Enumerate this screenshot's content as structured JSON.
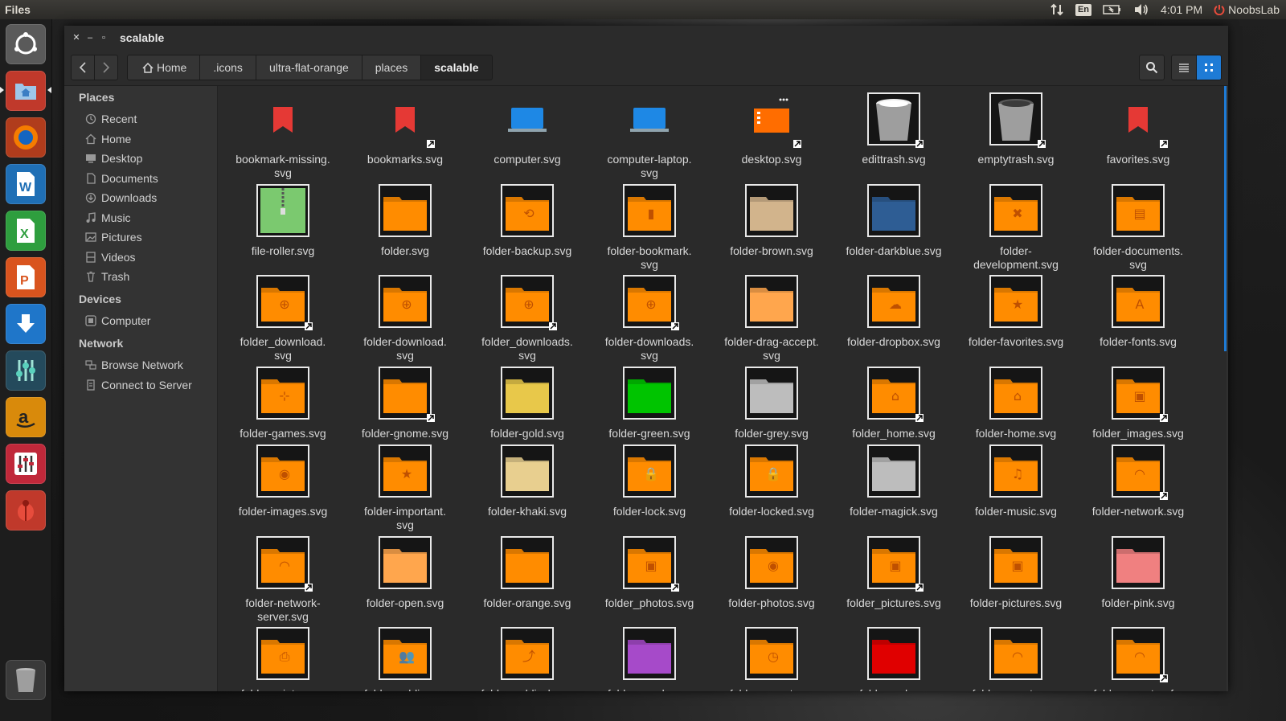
{
  "panel": {
    "app_title": "Files",
    "lang": "En",
    "time": "4:01 PM",
    "user": "NoobsLab"
  },
  "launcher": {
    "items": [
      "ubuntu-dash-icon",
      "files-app-icon",
      "firefox-icon",
      "libreoffice-writer-icon",
      "libreoffice-calc-icon",
      "libreoffice-impress-icon",
      "ubuntu-software-icon",
      "system-settings-icon",
      "amazon-icon",
      "mixer-app-icon",
      "bug-report-icon",
      "trash-launcher-icon"
    ]
  },
  "window": {
    "title": "scalable"
  },
  "breadcrumbs": [
    {
      "label": "Home",
      "active": false
    },
    {
      "label": ".icons",
      "active": false
    },
    {
      "label": "ultra-flat-orange",
      "active": false
    },
    {
      "label": "places",
      "active": false
    },
    {
      "label": "scalable",
      "active": true
    }
  ],
  "sidebar": {
    "places_heading": "Places",
    "places": [
      {
        "label": "Recent",
        "icon": "recent-icon"
      },
      {
        "label": "Home",
        "icon": "home-icon"
      },
      {
        "label": "Desktop",
        "icon": "desktop-icon"
      },
      {
        "label": "Documents",
        "icon": "documents-icon"
      },
      {
        "label": "Downloads",
        "icon": "downloads-icon"
      },
      {
        "label": "Music",
        "icon": "music-icon"
      },
      {
        "label": "Pictures",
        "icon": "pictures-icon"
      },
      {
        "label": "Videos",
        "icon": "videos-icon"
      },
      {
        "label": "Trash",
        "icon": "trash-icon"
      }
    ],
    "devices_heading": "Devices",
    "devices": [
      {
        "label": "Computer",
        "icon": "computer-icon"
      }
    ],
    "network_heading": "Network",
    "network": [
      {
        "label": "Browse Network",
        "icon": "network-icon"
      },
      {
        "label": "Connect to Server",
        "icon": "server-icon"
      }
    ]
  },
  "files": [
    {
      "name": "bookmark-missing.\nsvg",
      "kind": "bookmark",
      "color": "#e53935",
      "link": false
    },
    {
      "name": "bookmarks.svg",
      "kind": "bookmark",
      "color": "#e53935",
      "link": true
    },
    {
      "name": "computer.svg",
      "kind": "laptop",
      "color": "#1e88e5",
      "link": false
    },
    {
      "name": "computer-laptop.\nsvg",
      "kind": "laptop",
      "color": "#1e88e5",
      "link": false
    },
    {
      "name": "desktop.svg",
      "kind": "desktop",
      "color": "#ff6d00",
      "link": true
    },
    {
      "name": "edittrash.svg",
      "kind": "trashfull",
      "color": "#9e9e9e",
      "link": true
    },
    {
      "name": "emptytrash.svg",
      "kind": "trash",
      "color": "#9e9e9e",
      "link": true
    },
    {
      "name": "favorites.svg",
      "kind": "bookmark",
      "color": "#e53935",
      "link": true
    },
    {
      "name": "file-roller.svg",
      "kind": "archive",
      "color": "#7bc96f",
      "link": false
    },
    {
      "name": "folder.svg",
      "kind": "folder",
      "color": "#ff8c00",
      "glyph": "",
      "link": false
    },
    {
      "name": "folder-backup.svg",
      "kind": "folder",
      "color": "#ff8c00",
      "glyph": "⟲",
      "link": false
    },
    {
      "name": "folder-bookmark.\nsvg",
      "kind": "folder",
      "color": "#ff8c00",
      "glyph": "▮",
      "link": false
    },
    {
      "name": "folder-brown.svg",
      "kind": "folder",
      "color": "#d2b48c",
      "glyph": "",
      "link": false
    },
    {
      "name": "folder-darkblue.svg",
      "kind": "folder",
      "color": "#2e5d94",
      "glyph": "",
      "link": false
    },
    {
      "name": "folder-\ndevelopment.svg",
      "kind": "folder",
      "color": "#ff8c00",
      "glyph": "✖",
      "link": false
    },
    {
      "name": "folder-documents.\nsvg",
      "kind": "folder",
      "color": "#ff8c00",
      "glyph": "▤",
      "link": false
    },
    {
      "name": "folder_download.\nsvg",
      "kind": "folder",
      "color": "#ff8c00",
      "glyph": "⊕",
      "link": true
    },
    {
      "name": "folder-download.\nsvg",
      "kind": "folder",
      "color": "#ff8c00",
      "glyph": "⊕",
      "link": false
    },
    {
      "name": "folder_downloads.\nsvg",
      "kind": "folder",
      "color": "#ff8c00",
      "glyph": "⊕",
      "link": true
    },
    {
      "name": "folder-downloads.\nsvg",
      "kind": "folder",
      "color": "#ff8c00",
      "glyph": "⊕",
      "link": true
    },
    {
      "name": "folder-drag-accept.\nsvg",
      "kind": "folder",
      "color": "#ffa64d",
      "glyph": "",
      "link": false
    },
    {
      "name": "folder-dropbox.svg",
      "kind": "folder",
      "color": "#ff8c00",
      "glyph": "☁",
      "link": false
    },
    {
      "name": "folder-favorites.svg",
      "kind": "folder",
      "color": "#ff8c00",
      "glyph": "★",
      "link": false
    },
    {
      "name": "folder-fonts.svg",
      "kind": "folder",
      "color": "#ff8c00",
      "glyph": "A",
      "link": false
    },
    {
      "name": "folder-games.svg",
      "kind": "folder",
      "color": "#ff8c00",
      "glyph": "⊹",
      "link": false
    },
    {
      "name": "folder-gnome.svg",
      "kind": "folder",
      "color": "#ff8c00",
      "glyph": "",
      "link": true
    },
    {
      "name": "folder-gold.svg",
      "kind": "folder",
      "color": "#e8c84a",
      "glyph": "",
      "link": false
    },
    {
      "name": "folder-green.svg",
      "kind": "folder",
      "color": "#00c400",
      "glyph": "",
      "link": false
    },
    {
      "name": "folder-grey.svg",
      "kind": "folder",
      "color": "#bdbdbd",
      "glyph": "",
      "link": false
    },
    {
      "name": "folder_home.svg",
      "kind": "folder",
      "color": "#ff8c00",
      "glyph": "⌂",
      "link": true
    },
    {
      "name": "folder-home.svg",
      "kind": "folder",
      "color": "#ff8c00",
      "glyph": "⌂",
      "link": false
    },
    {
      "name": "folder_images.svg",
      "kind": "folder",
      "color": "#ff8c00",
      "glyph": "▣",
      "link": true
    },
    {
      "name": "folder-images.svg",
      "kind": "folder",
      "color": "#ff8c00",
      "glyph": "◉",
      "link": false
    },
    {
      "name": "folder-important.\nsvg",
      "kind": "folder",
      "color": "#ff8c00",
      "glyph": "★",
      "link": false
    },
    {
      "name": "folder-khaki.svg",
      "kind": "folder",
      "color": "#e8cf8f",
      "glyph": "",
      "link": false
    },
    {
      "name": "folder-lock.svg",
      "kind": "folder",
      "color": "#ff8c00",
      "glyph": "🔒",
      "link": false
    },
    {
      "name": "folder-locked.svg",
      "kind": "folder",
      "color": "#ff8c00",
      "glyph": "🔒",
      "link": false
    },
    {
      "name": "folder-magick.svg",
      "kind": "folder",
      "color": "#bdbdbd",
      "glyph": "",
      "link": false
    },
    {
      "name": "folder-music.svg",
      "kind": "folder",
      "color": "#ff8c00",
      "glyph": "♫",
      "link": false
    },
    {
      "name": "folder-network.svg",
      "kind": "folder",
      "color": "#ff8c00",
      "glyph": "◠",
      "link": true
    },
    {
      "name": "folder-network-\nserver.svg",
      "kind": "folder",
      "color": "#ff8c00",
      "glyph": "◠",
      "link": true
    },
    {
      "name": "folder-open.svg",
      "kind": "folder",
      "color": "#ffa64d",
      "glyph": "",
      "link": false
    },
    {
      "name": "folder-orange.svg",
      "kind": "folder",
      "color": "#ff8c00",
      "glyph": "",
      "link": false
    },
    {
      "name": "folder_photos.svg",
      "kind": "folder",
      "color": "#ff8c00",
      "glyph": "▣",
      "link": true
    },
    {
      "name": "folder-photos.svg",
      "kind": "folder",
      "color": "#ff8c00",
      "glyph": "◉",
      "link": false
    },
    {
      "name": "folder_pictures.svg",
      "kind": "folder",
      "color": "#ff8c00",
      "glyph": "▣",
      "link": true
    },
    {
      "name": "folder-pictures.svg",
      "kind": "folder",
      "color": "#ff8c00",
      "glyph": "▣",
      "link": false
    },
    {
      "name": "folder-pink.svg",
      "kind": "folder",
      "color": "#f08080",
      "glyph": "",
      "link": false
    },
    {
      "name": "folder-printer.svg",
      "kind": "folder",
      "color": "#ff8c00",
      "glyph": "⎙",
      "link": false
    },
    {
      "name": "folder-public.svg",
      "kind": "folder",
      "color": "#ff8c00",
      "glyph": "👥",
      "link": false
    },
    {
      "name": "folder-publicshare.\nsvg",
      "kind": "folder",
      "color": "#ff8c00",
      "glyph": "⤴",
      "link": false
    },
    {
      "name": "folder-purple.svg",
      "kind": "folder",
      "color": "#a64ac9",
      "glyph": "",
      "link": false
    },
    {
      "name": "folder-recent.svg",
      "kind": "folder",
      "color": "#ff8c00",
      "glyph": "◷",
      "link": false
    },
    {
      "name": "folder-red.svg",
      "kind": "folder",
      "color": "#e00000",
      "glyph": "",
      "link": false
    },
    {
      "name": "folder-remote.svg",
      "kind": "folder",
      "color": "#ff8c00",
      "glyph": "◠",
      "link": false
    },
    {
      "name": "folder-remote-afp.\nsvg",
      "kind": "folder",
      "color": "#ff8c00",
      "glyph": "◠",
      "link": true
    }
  ]
}
